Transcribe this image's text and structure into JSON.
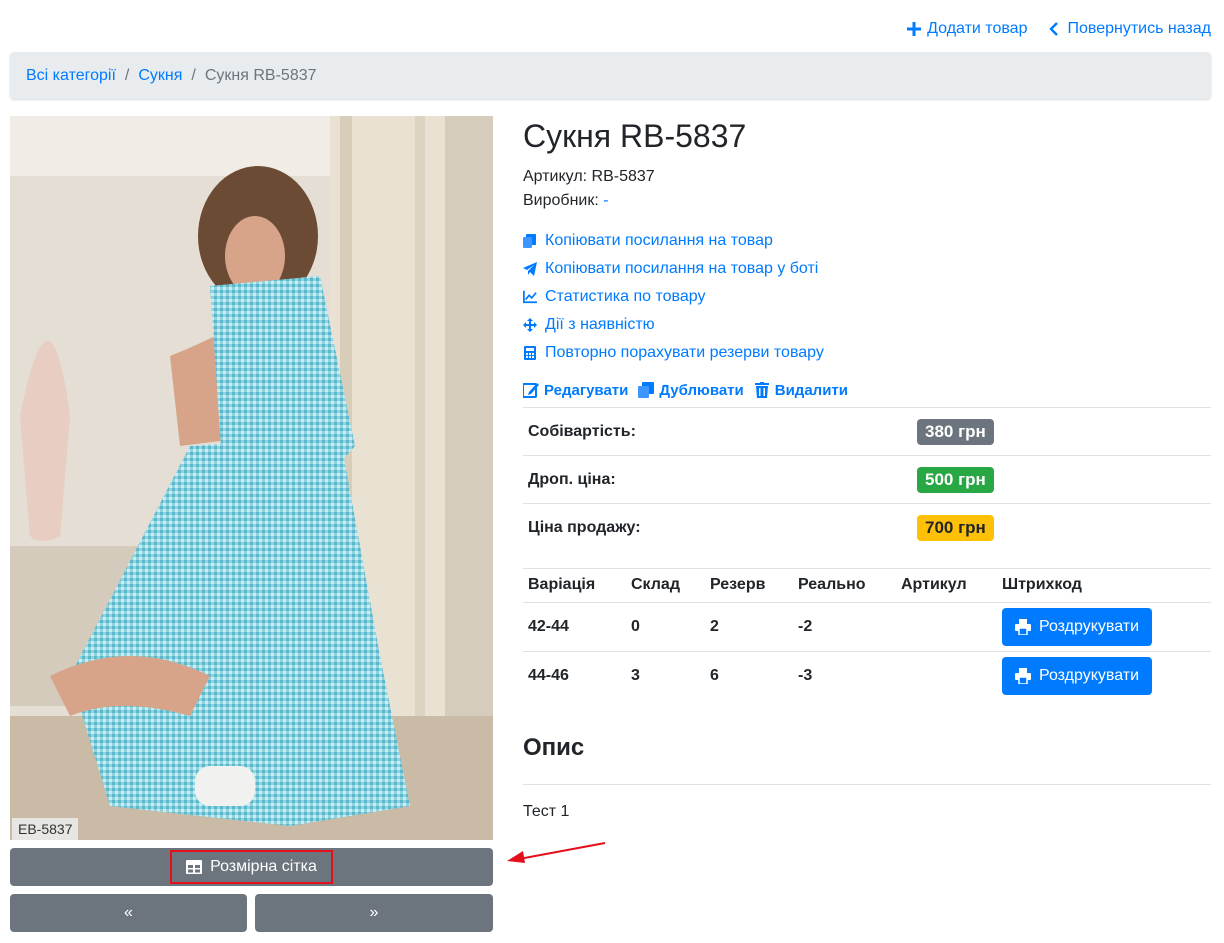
{
  "header": {
    "add_product": "Додати товар",
    "go_back": "Повернутись назад"
  },
  "breadcrumb": {
    "root": "Всі категорії",
    "category": "Сукня",
    "current": "Сукня RB-5837"
  },
  "photo": {
    "sku_tag": "EB-5837"
  },
  "buttons": {
    "size_chart": "Розмірна сітка",
    "prev": "«",
    "next": "»"
  },
  "product": {
    "title": "Сукня RB-5837",
    "sku_label": "Артикул:",
    "sku_value": "RB-5837",
    "manufacturer_label": "Виробник:",
    "manufacturer_value": "-"
  },
  "links": {
    "copy_link": "Копіювати посилання на товар",
    "copy_bot_link": "Копіювати посилання на товар у боті",
    "stats": "Статистика по товару",
    "stock_actions": "Дії з наявністю",
    "recalc_reserves": "Повторно порахувати резерви товару"
  },
  "actions": {
    "edit": "Редагувати",
    "duplicate": "Дублювати",
    "delete": "Видалити"
  },
  "prices": [
    {
      "label": "Собівартість:",
      "value": "380 грн",
      "color": "#6c757d"
    },
    {
      "label": "Дроп. ціна:",
      "value": "500 грн",
      "color": "#28a745"
    },
    {
      "label": "Ціна продажу:",
      "value": "700 грн",
      "color": "#ffc107"
    }
  ],
  "variations": {
    "headers": [
      "Варіація",
      "Склад",
      "Резерв",
      "Реально",
      "Артикул",
      "Штрихкод"
    ],
    "rows": [
      {
        "variation": "42-44",
        "stock": "0",
        "reserve": "2",
        "real": "-2",
        "sku": "",
        "print": "Роздрукувати"
      },
      {
        "variation": "44-46",
        "stock": "3",
        "reserve": "6",
        "real": "-3",
        "sku": "",
        "print": "Роздрукувати"
      }
    ]
  },
  "description": {
    "title": "Опис",
    "text": "Тест 1"
  }
}
